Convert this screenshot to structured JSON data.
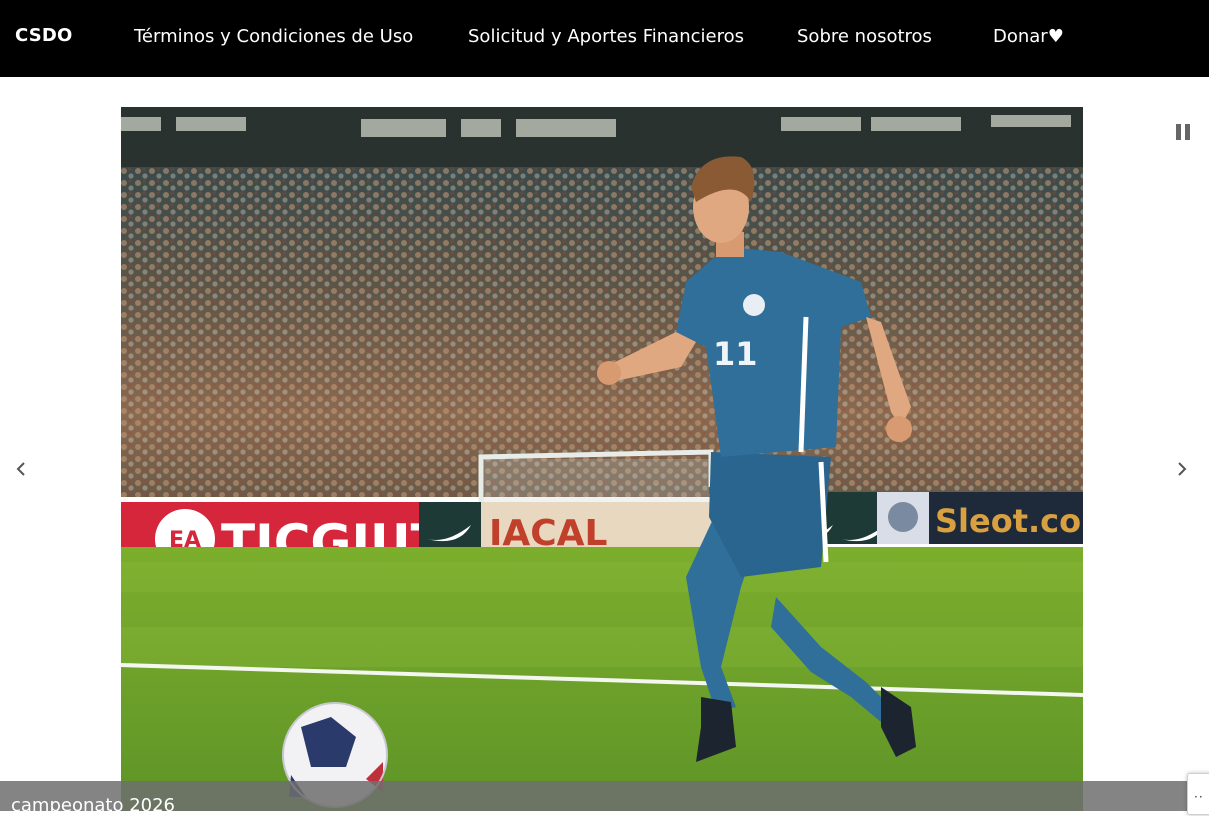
{
  "navbar": {
    "brand": "CSDO",
    "links": [
      {
        "label": "Términos y Condiciones de Uso"
      },
      {
        "label": "Solicitud y Aportes Financieros"
      },
      {
        "label": "Sobre nosotros"
      },
      {
        "label": "Donar♥"
      }
    ]
  },
  "slider": {
    "caption": "campeonato 2026",
    "image": {
      "banner_left": "TICGIUT",
      "banner_badge": "EA",
      "banner_mid": "IACAL",
      "banner_right": "Sleot.co",
      "jersey_number": "11"
    },
    "controls": {
      "prev_icon": "chevron-left-icon",
      "next_icon": "chevron-right-icon",
      "pause_icon": "pause-icon"
    }
  },
  "widget": {
    "icon": "more-dots-icon",
    "label": "··"
  },
  "colors": {
    "navbar_bg": "#000000",
    "jersey": "#2f6f9a",
    "banner_red": "#d6263c",
    "pitch": "#6aa028"
  }
}
